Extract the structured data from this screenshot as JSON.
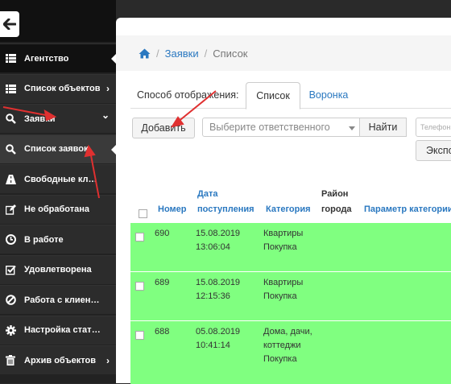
{
  "sidebar": {
    "items": [
      {
        "label": "Агентство",
        "icon": "list-icon",
        "chevron": "",
        "style": "dark",
        "notch": true
      },
      {
        "label": "Список объектов",
        "icon": "list-icon",
        "chevron": "›",
        "style": "normal",
        "notch": false
      },
      {
        "label": "Заявки",
        "icon": "search-icon",
        "chevron": "⌄",
        "style": "normal",
        "notch": false
      },
      {
        "label": "Список заявок",
        "icon": "search-icon",
        "chevron": "",
        "style": "active",
        "notch": true
      },
      {
        "label": "Свободные клие...",
        "icon": "road-icon",
        "chevron": "",
        "style": "normal",
        "notch": false
      },
      {
        "label": "Не обработана",
        "icon": "edit-icon",
        "chevron": "",
        "style": "normal",
        "notch": false
      },
      {
        "label": "В работе",
        "icon": "clock-icon",
        "chevron": "",
        "style": "normal",
        "notch": false
      },
      {
        "label": "Удовлетворена",
        "icon": "check-square-icon",
        "chevron": "",
        "style": "normal",
        "notch": false
      },
      {
        "label": "Работа с клиенто...",
        "icon": "ban-icon",
        "chevron": "",
        "style": "normal",
        "notch": false
      },
      {
        "label": "Настройка статус...",
        "icon": "gear-icon",
        "chevron": "",
        "style": "normal",
        "notch": false
      },
      {
        "label": "Архив объектов",
        "icon": "trash-icon",
        "chevron": "›",
        "style": "normal",
        "notch": false
      }
    ]
  },
  "breadcrumb": {
    "home_icon": "home-icon",
    "items": [
      "Заявки",
      "Список"
    ]
  },
  "view": {
    "label": "Способ отображения:",
    "tabs": [
      "Список",
      "Воронка"
    ]
  },
  "toolbar": {
    "add_label": "Добавить",
    "responsible_placeholder": "Выберите ответственного",
    "find_label": "Найти",
    "phone_placeholder": "Телефон",
    "export_label": "Экспо"
  },
  "table": {
    "headers": {
      "number": "Номер",
      "date_line1": "Дата",
      "date_line2": "поступления",
      "category": "Категория",
      "district_line1": "Район",
      "district_line2": "города",
      "param": "Параметр категории"
    },
    "rows": [
      {
        "number": "690",
        "date": "15.08.2019",
        "time": "13:06:04",
        "category": [
          "Квартиры",
          "Покупка"
        ]
      },
      {
        "number": "689",
        "date": "15.08.2019",
        "time": "12:15:36",
        "category": [
          "Квартиры",
          "Покупка"
        ]
      },
      {
        "number": "688",
        "date": "05.08.2019",
        "time": "10:41:14",
        "category": [
          "Дома, дачи,",
          "коттеджи",
          "Покупка"
        ]
      }
    ]
  },
  "colors": {
    "row_highlight": "#80ff80",
    "link": "#2a78c0",
    "annotation_arrow": "#e03030"
  }
}
